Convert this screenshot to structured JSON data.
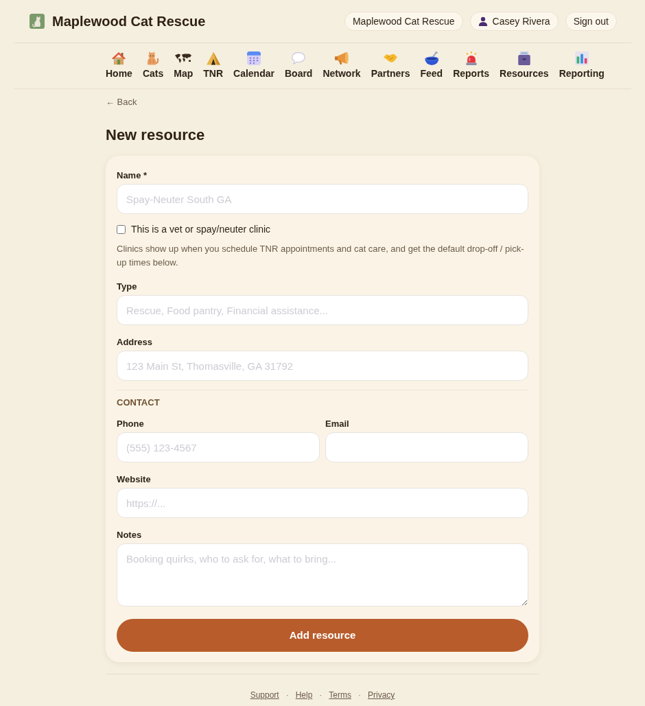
{
  "header": {
    "title": "Maplewood Cat Rescue",
    "buttons": [
      {
        "kind": "org",
        "label": "Maplewood Cat Rescue"
      },
      {
        "kind": "user",
        "label": "Casey Rivera"
      },
      {
        "kind": "plain",
        "label": "Sign out"
      }
    ]
  },
  "nav": [
    "Home",
    "Cats",
    "Map",
    "TNR",
    "Calendar",
    "Board",
    "Network",
    "Partners",
    "Feed",
    "Reports",
    "Resources",
    "Reporting"
  ],
  "back_link": "← Back",
  "page_title": "New resource",
  "form": {
    "items": [
      {
        "kind": "text",
        "label": "Name *",
        "placeholder": "Spay-Neuter South GA"
      },
      {
        "kind": "checkbox",
        "label": "This is a vet or spay/neuter clinic",
        "checked": false
      },
      {
        "kind": "help",
        "text": "Clinics show up when you schedule TNR appointments and cat care, and get the default drop-off / pick-up times below."
      },
      {
        "kind": "text",
        "label": "Type",
        "placeholder": "Rescue, Food pantry, Financial assistance..."
      },
      {
        "kind": "text",
        "label": "Address",
        "placeholder": "123 Main St, Thomasville, GA 31792"
      },
      {
        "kind": "section",
        "text": "CONTACT"
      },
      {
        "kind": "pair",
        "fields": [
          {
            "label": "Phone",
            "placeholder": "(555) 123-4567"
          },
          {
            "label": "Email"
          }
        ]
      },
      {
        "kind": "text",
        "label": "Website",
        "placeholder": "https://..."
      },
      {
        "kind": "textarea",
        "label": "Notes",
        "placeholder": "Booking quirks, who to ask for, what to bring..."
      }
    ],
    "submit": "Add resource"
  },
  "footer": [
    {
      "kind": "link",
      "text": "Support"
    },
    {
      "kind": "separator",
      "text": "·"
    },
    {
      "kind": "link",
      "text": "Help"
    },
    {
      "kind": "separator",
      "text": "·"
    },
    {
      "kind": "link",
      "text": "Terms"
    },
    {
      "kind": "separator",
      "text": "·"
    },
    {
      "kind": "link",
      "text": "Privacy"
    }
  ]
}
